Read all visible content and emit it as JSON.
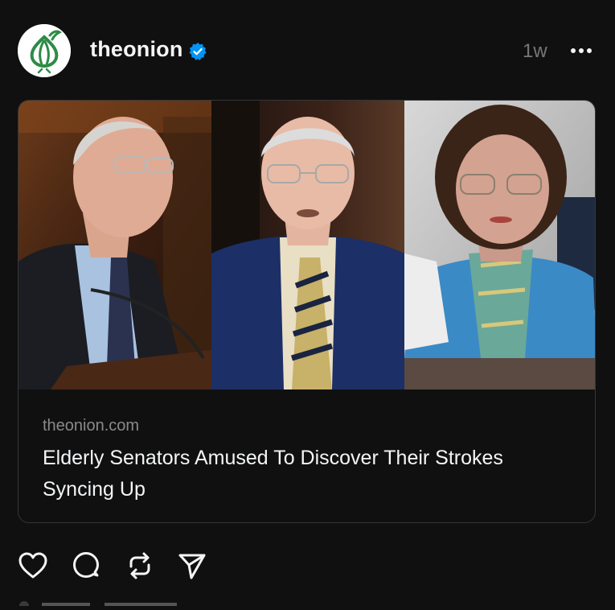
{
  "post": {
    "username": "theonion",
    "verified": true,
    "timestamp": "1w",
    "avatar_icon": "onion-logo-icon",
    "more_icon": "more-options-icon"
  },
  "link_card": {
    "domain": "theonion.com",
    "headline": "Elderly Senators Amused To Discover Their Strokes Syncing Up",
    "images": [
      "senator-photo-left",
      "senator-photo-center",
      "senator-photo-right"
    ]
  },
  "actions": [
    {
      "icon": "heart-icon"
    },
    {
      "icon": "comment-icon"
    },
    {
      "icon": "repost-icon"
    },
    {
      "icon": "share-icon"
    }
  ],
  "colors": {
    "background": "#101010",
    "text_primary": "#f3f5f7",
    "text_secondary": "#8a8a8a",
    "card_border": "#333638",
    "verified_blue": "#0095f6",
    "onion_green": "#2e8b47"
  }
}
